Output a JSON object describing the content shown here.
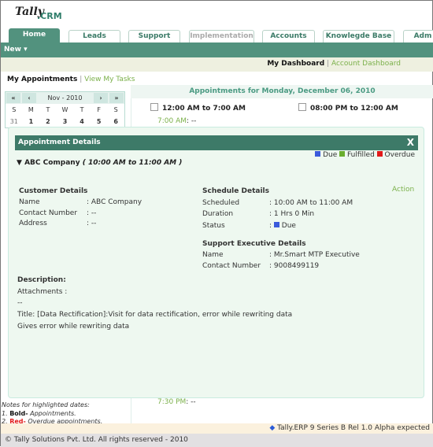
{
  "header": {
    "logo": "Tally",
    "logo_suffix": ".CRM"
  },
  "tabs": [
    {
      "label": "Home"
    },
    {
      "label": "Leads"
    },
    {
      "label": "Support"
    },
    {
      "label": "Implementation"
    },
    {
      "label": "Accounts"
    },
    {
      "label": "Knowlegde Base"
    },
    {
      "label": "Adm"
    }
  ],
  "toolbar": {
    "new_label": "New"
  },
  "dashboard": {
    "my": "My Dashboard",
    "account": "Account Dashboard"
  },
  "subnav": {
    "appointments": "My Appointments",
    "tasks": "View My Tasks"
  },
  "calendar": {
    "month": "Nov -",
    "year": "2010",
    "prev_year": "«",
    "prev": "‹",
    "next": "›",
    "next_year": "»",
    "weekdays": [
      "S",
      "M",
      "T",
      "W",
      "T",
      "F",
      "S"
    ],
    "first_week": [
      "31",
      "1",
      "2",
      "3",
      "4",
      "5",
      "6"
    ]
  },
  "appointments": {
    "heading": "Appointments for Monday, December 06, 2010",
    "slot1": "12:00 AM to 7:00 AM",
    "slot2": "08:00 PM to 12:00 AM",
    "time1": "7:00 AM",
    "time1_value": ": --",
    "time2": "7:30 PM",
    "time2_value": ": --"
  },
  "notes": {
    "title": "Notes for highlighted dates:",
    "n1_num": "1.",
    "n1_key": "Bold-",
    "n1_text": "Appointments.",
    "n2_num": "2.",
    "n2_key": "Red-",
    "n2_text": "Overdue appointments."
  },
  "modal": {
    "title": "Appointment Details",
    "close": "X",
    "legend": [
      {
        "label": "Due",
        "color": "#3b5bdb"
      },
      {
        "label": "Fulfilled",
        "color": "#6aae2e"
      },
      {
        "label": "Overdue",
        "color": "#e21a1a"
      }
    ],
    "company": "ABC Company",
    "time_range": "( 10:00 AM to 11:00 AM )",
    "action": "Action",
    "customer": {
      "heading": "Customer Details",
      "rows": [
        {
          "label": "Name",
          "value": ": ABC Company"
        },
        {
          "label": "Contact Number",
          "value": ": --"
        },
        {
          "label": "Address",
          "value": ": --"
        }
      ]
    },
    "schedule": {
      "heading": "Schedule Details",
      "rows": [
        {
          "label": "Scheduled",
          "value": ": 10:00 AM to 11:00 AM"
        },
        {
          "label": "Duration",
          "value": ": 1 Hrs 0 Min"
        },
        {
          "label": "Status",
          "value": "Due"
        }
      ]
    },
    "executive": {
      "heading": "Support Executive Details",
      "rows": [
        {
          "label": "Name",
          "value": ": Mr.Smart MTP Executive"
        },
        {
          "label": "Contact Number",
          "value": ": 9008499119"
        }
      ]
    },
    "description": {
      "heading": "Description:",
      "attachments": "Attachments :",
      "attachments_value": "--",
      "title": "Title: [Data Rectification]:Visit for data rectification, error while rewriting data",
      "body": "Gives error while rewriting data"
    }
  },
  "ticker": "Tally.ERP 9 Series B Rel 1.0 Alpha expected",
  "footer": "© Tally Solutions Pvt. Ltd. All rights reserved - 2010"
}
